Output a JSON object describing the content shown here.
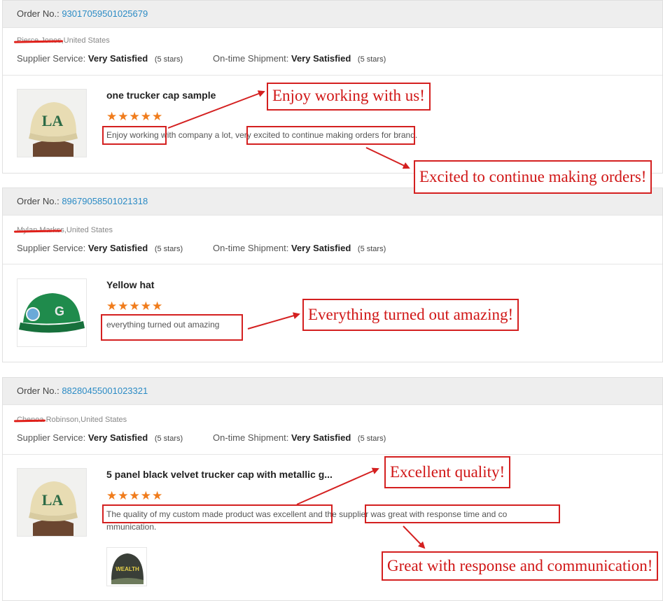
{
  "orders": [
    {
      "order_label": "Order No.:",
      "order_no": "93017059501025679",
      "buyer_redacted": "Pierce Jones",
      "buyer_location": ",United States",
      "supplier_label": "Supplier Service:",
      "supplier_value": "Very Satisfied",
      "supplier_stars": "(5 stars)",
      "shipment_label": "On-time Shipment:",
      "shipment_value": "Very Satisfied",
      "shipment_stars": "(5 stars)",
      "product_title": "one trucker cap sample",
      "rating": 5,
      "review_1": "Enjoy working with company a lot, very excited to continue making orders for brand.",
      "review_2": ""
    },
    {
      "order_label": "Order No.:",
      "order_no": "89679058501021318",
      "buyer_redacted": "Mylan Marks",
      "buyer_location": "s,United States",
      "supplier_label": "Supplier Service:",
      "supplier_value": "Very Satisfied",
      "supplier_stars": "(5 stars)",
      "shipment_label": "On-time Shipment:",
      "shipment_value": "Very Satisfied",
      "shipment_stars": "(5 stars)",
      "product_title": "Yellow hat",
      "rating": 5,
      "review_1": "everything turned out amazing",
      "review_2": ""
    },
    {
      "order_label": "Order No.:",
      "order_no": "88280455001023321",
      "buyer_redacted": "Chenoa",
      "buyer_location": " Robinson,United States",
      "supplier_label": "Supplier Service:",
      "supplier_value": "Very Satisfied",
      "supplier_stars": "(5 stars)",
      "shipment_label": "On-time Shipment:",
      "shipment_value": "Very Satisfied",
      "shipment_stars": "(5 stars)",
      "product_title": "5 panel black velvet trucker cap with metallic g...",
      "rating": 5,
      "review_1": "The quality of my custom made product was excellent and the supplier was great with response time and co",
      "review_2": "mmunication."
    }
  ],
  "callouts": {
    "c1": "Enjoy working with us!",
    "c2": "Excited to continue making orders!",
    "c3": "Everything turned out amazing!",
    "c4": "Excellent quality!",
    "c5": "Great with response and communication!"
  },
  "images": {
    "cap_la_letters": "LA",
    "cap_g_letter": "G",
    "cap_wealth_text": "WEALTH"
  },
  "colors": {
    "accent_link": "#2b8bc5",
    "star": "#f07c1c",
    "annotation_red": "#d42020"
  }
}
